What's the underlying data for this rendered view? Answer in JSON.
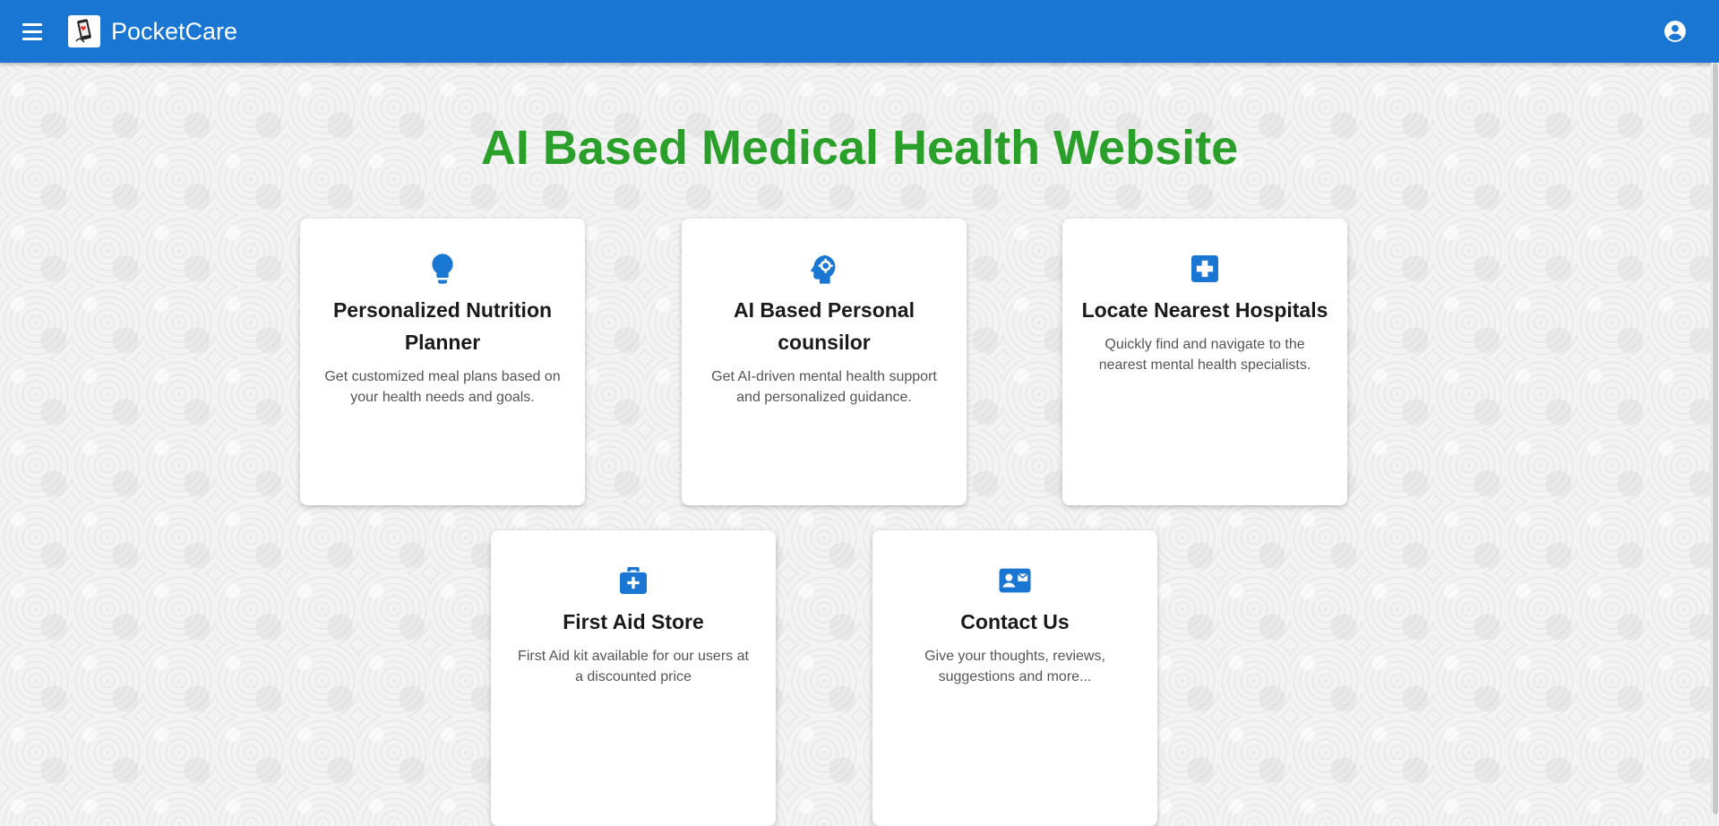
{
  "header": {
    "brand": "PocketCare",
    "menu_icon": "menu-icon",
    "logo_icon": "phone-heart-logo",
    "account_icon": "account-circle-icon",
    "color": "#1976d2"
  },
  "hero": {
    "title": "AI Based Medical Health Website",
    "title_color": "#2aa02a"
  },
  "cards": [
    {
      "icon": "lightbulb-icon",
      "title": "Personalized Nutrition Planner",
      "description": "Get customized meal plans based on your health needs and goals."
    },
    {
      "icon": "psychology-icon",
      "title": "AI Based Personal counsilor",
      "description": "Get AI-driven mental health support and personalized guidance."
    },
    {
      "icon": "local-hospital-icon",
      "title": "Locate Nearest Hospitals",
      "description": "Quickly find and navigate to the nearest mental health specialists."
    },
    {
      "icon": "medical-services-icon",
      "title": "First Aid Store",
      "description": "First Aid kit available for our users at a discounted price"
    },
    {
      "icon": "contact-mail-icon",
      "title": "Contact Us",
      "description": "Give your thoughts, reviews, suggestions and more..."
    }
  ],
  "accent_color": "#1976d2"
}
